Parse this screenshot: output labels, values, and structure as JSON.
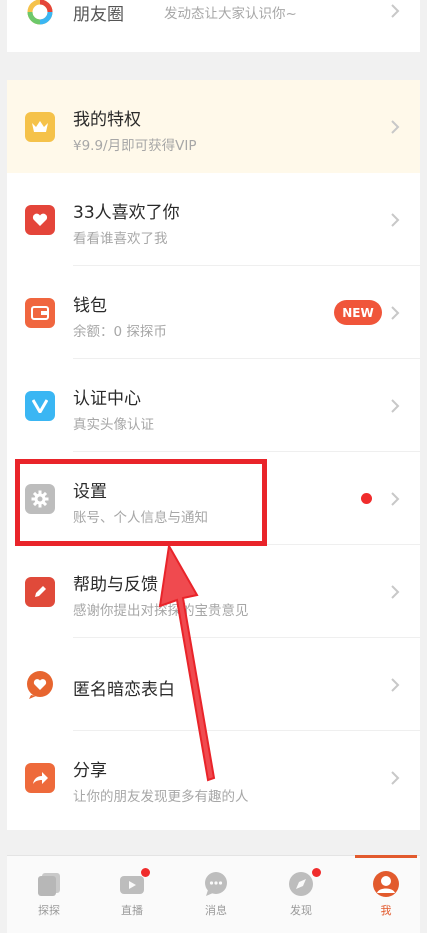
{
  "moments": {
    "title": "朋友圈",
    "subtitle": "发动态让大家认识你~"
  },
  "menu": {
    "privilege": {
      "title": "我的特权",
      "subtitle": "¥9.9/月即可获得VIP"
    },
    "likes": {
      "title": "33人喜欢了你",
      "subtitle": "看看谁喜欢了我"
    },
    "wallet": {
      "title": "钱包",
      "subtitle": "余额：0 探探币",
      "badge": "NEW"
    },
    "verify": {
      "title": "认证中心",
      "subtitle": "真实头像认证"
    },
    "settings": {
      "title": "设置",
      "subtitle": "账号、个人信息与通知"
    },
    "help": {
      "title": "帮助与反馈",
      "subtitle": "感谢你提出对探探的宝贵意见"
    },
    "crush": {
      "title": "匿名暗恋表白"
    },
    "share": {
      "title": "分享",
      "subtitle": "让你的朋友发现更多有趣的人"
    }
  },
  "tabs": [
    {
      "label": "探探",
      "icon": "cards-icon"
    },
    {
      "label": "直播",
      "icon": "live-tv-icon"
    },
    {
      "label": "消息",
      "icon": "chat-bubble-icon"
    },
    {
      "label": "发现",
      "icon": "compass-icon"
    },
    {
      "label": "我",
      "icon": "profile-avatar-icon"
    }
  ],
  "colors": {
    "accent": "#e9242a",
    "privilege_bg": "#fff9ea",
    "crown": "#f5c24a",
    "heart_red": "#e4453a",
    "wallet_orange": "#f0663f",
    "verify_blue": "#3ab6f3",
    "settings_gray": "#bdbdbd",
    "help_red": "#e04a3a",
    "crush_orange": "#e7652f",
    "share_orange": "#ee6a3b",
    "badge_red": "#f0553a",
    "dot_red": "#f02c2c"
  }
}
